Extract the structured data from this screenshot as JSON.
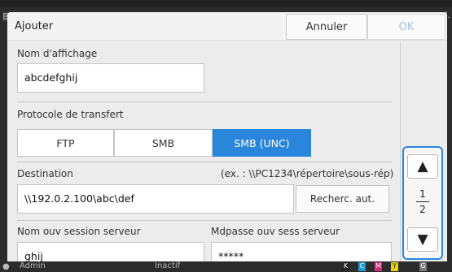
{
  "background": {
    "left_icon": "printer-icon",
    "right_text": "l."
  },
  "dialog": {
    "title": "Ajouter",
    "cancel_label": "Annuler",
    "ok_label": "OK"
  },
  "form": {
    "display_name": {
      "label": "Nom d'affichage",
      "value": "abcdefghij"
    },
    "protocol": {
      "label": "Protocole de transfert",
      "options": [
        "FTP",
        "SMB",
        "SMB (UNC)"
      ],
      "selected": "SMB (UNC)"
    },
    "destination": {
      "label": "Destination",
      "hint": "(ex. : \\\\PC1234\\répertoire\\sous-rép)",
      "value": "\\\\192.0.2.100\\abc\\def",
      "search_button": "Recherc. aut."
    },
    "login_name": {
      "label": "Nom ouv session serveur",
      "value": "ghij"
    },
    "login_password": {
      "label": "Mdpasse ouv sess serveur",
      "value": "*****"
    }
  },
  "pager": {
    "current": "1",
    "total": "2",
    "up_icon": "triangle-up-icon",
    "down_icon": "triangle-down-icon"
  },
  "status_bar": {
    "user": "Admin",
    "state": "Inactif",
    "inks": [
      "K",
      "C",
      "M",
      "Y",
      "G"
    ],
    "colors": {
      "C": "#1a9bd7",
      "M": "#d6287b",
      "Y": "#e6d200",
      "K": "#222222",
      "G": "#7a7a7a"
    }
  },
  "colors": {
    "accent": "#2a86db",
    "ok_disabled": "#9fc3e8"
  }
}
